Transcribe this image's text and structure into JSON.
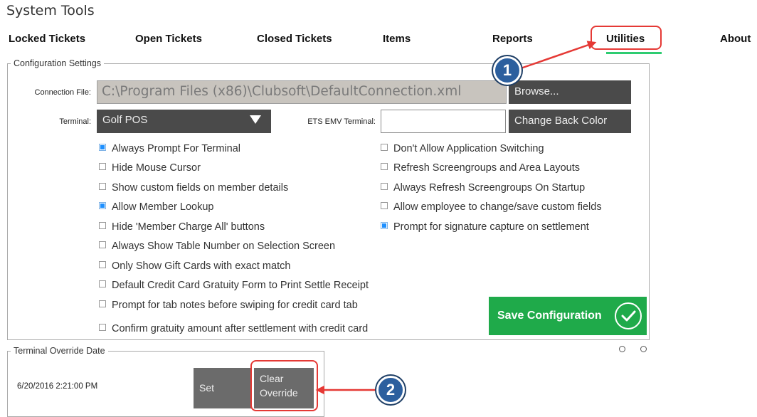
{
  "app_title": "System Tools",
  "tabs": [
    {
      "label": "Locked Tickets"
    },
    {
      "label": "Open Tickets"
    },
    {
      "label": "Closed Tickets"
    },
    {
      "label": "Items"
    },
    {
      "label": "Reports"
    },
    {
      "label": "Utilities",
      "active": true
    },
    {
      "label": "About"
    }
  ],
  "config": {
    "legend": "Configuration Settings",
    "connection_label": "Connection File:",
    "connection_value": "C:\\Program Files (x86)\\Clubsoft\\DefaultConnection.xml",
    "browse_label": "Browse...",
    "terminal_label": "Terminal:",
    "terminal_value": "Golf POS",
    "ets_label": "ETS EMV Terminal:",
    "ets_value": "",
    "change_color_label": "Change Back Color",
    "left_options": [
      {
        "label": "Always Prompt For Terminal",
        "checked": true
      },
      {
        "label": "Hide Mouse Cursor",
        "checked": false
      },
      {
        "label": "Show custom fields on member details",
        "checked": false
      },
      {
        "label": "Allow Member Lookup",
        "checked": true
      },
      {
        "label": "Hide 'Member Charge All' buttons",
        "checked": false
      },
      {
        "label": "Always Show Table Number on Selection Screen",
        "checked": false
      },
      {
        "label": "Only Show Gift Cards with exact match",
        "checked": false
      },
      {
        "label": "Default Credit Card Gratuity Form to Print Settle Receipt",
        "checked": false
      },
      {
        "label": "Prompt for tab notes before swiping for credit card tab",
        "checked": false
      },
      {
        "label": "Confirm gratuity amount after settlement with credit card",
        "checked": false
      }
    ],
    "right_options": [
      {
        "label": "Don't Allow Application Switching",
        "checked": false
      },
      {
        "label": "Refresh Screengroups and Area Layouts",
        "checked": false
      },
      {
        "label": "Always Refresh Screengroups On Startup",
        "checked": false
      },
      {
        "label": "Allow employee to change/save custom fields",
        "checked": false
      },
      {
        "label": "Prompt for signature capture on settlement",
        "checked": true
      }
    ],
    "save_label": "Save Configuration"
  },
  "override": {
    "legend": "Terminal Override Date",
    "date_value": "6/20/2016 2:21:00 PM",
    "set_label": "Set",
    "clear_label_line1": "Clear",
    "clear_label_line2": "Override"
  },
  "callouts": [
    "1",
    "2"
  ],
  "colors": {
    "accent_green": "#1faa4a",
    "tab_underline": "#2ecc71",
    "annotation_red": "#e53935",
    "callout_blue": "#2c5f9e",
    "dark_button": "#4a4a4a"
  }
}
